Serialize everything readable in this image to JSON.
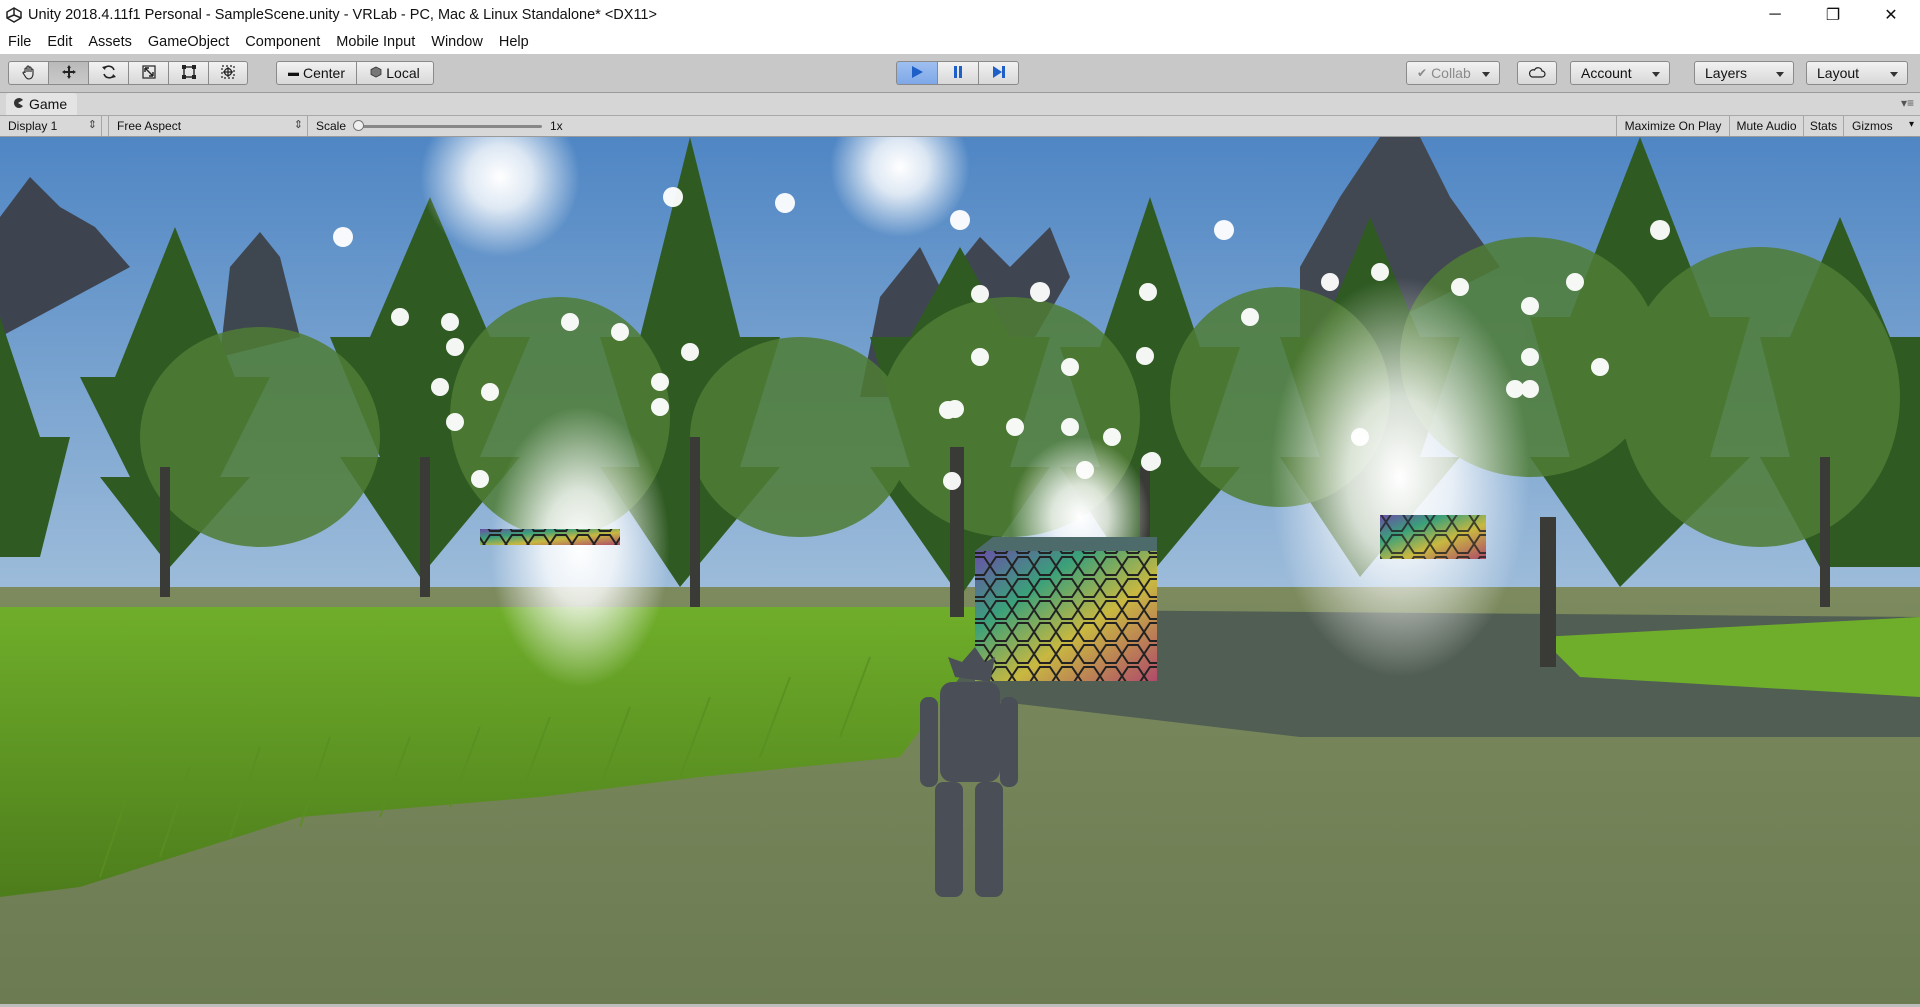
{
  "window": {
    "title": "Unity 2018.4.11f1 Personal - SampleScene.unity - VRLab - PC, Mac & Linux Standalone* <DX11>",
    "controls": {
      "minimize": "─",
      "restore": "❐",
      "close": "✕"
    }
  },
  "menu": [
    "File",
    "Edit",
    "Assets",
    "GameObject",
    "Component",
    "Mobile Input",
    "Window",
    "Help"
  ],
  "toolbar": {
    "transform_tools": [
      {
        "name": "hand-tool-icon",
        "glyph": "✋"
      },
      {
        "name": "move-tool-icon",
        "glyph": "✥"
      },
      {
        "name": "rotate-tool-icon",
        "glyph": "⟳"
      },
      {
        "name": "scale-tool-icon",
        "glyph": "⤢"
      },
      {
        "name": "rect-tool-icon",
        "glyph": "▣"
      },
      {
        "name": "transform-tool-icon",
        "glyph": "⊕"
      }
    ],
    "pivot_label": "Center",
    "space_label": "Local",
    "collab_label": "Collab",
    "account_label": "Account",
    "layers_label": "Layers",
    "layout_label": "Layout",
    "play_state": "playing"
  },
  "game_panel": {
    "tab_label": "Game",
    "display": "Display 1",
    "aspect": "Free Aspect",
    "scale_label": "Scale",
    "scale_value": "1x",
    "maximize_on_play": "Maximize On Play",
    "mute_audio": "Mute Audio",
    "stats": "Stats",
    "gizmos": "Gizmos"
  },
  "colors": {
    "play_accent": "#3a7bd5",
    "toolbar_bg": "#c8c8c8",
    "sky": "#5d8fc8",
    "grass": "#6a9a2a"
  }
}
